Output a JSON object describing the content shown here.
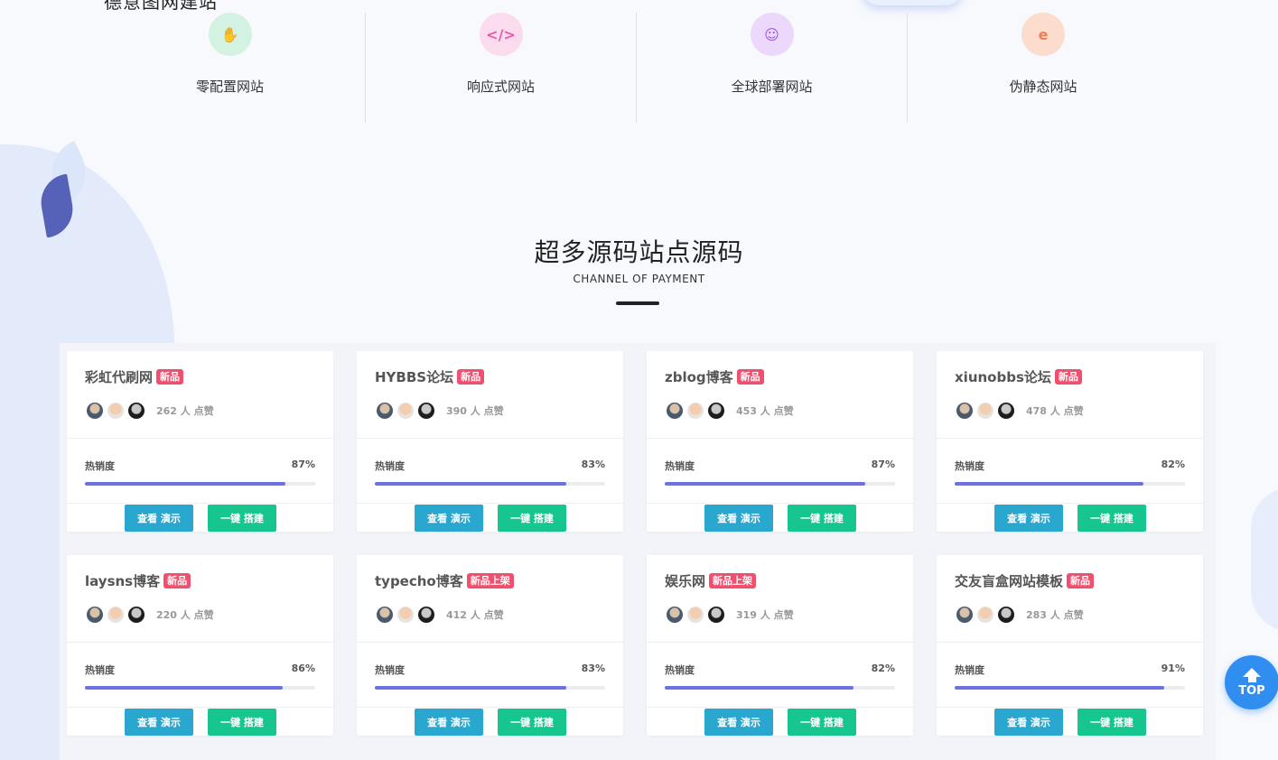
{
  "header_partial": {
    "title": "德意图网建站"
  },
  "features": [
    {
      "label": "零配置网站",
      "icon": "handshake-icon",
      "glyph": "✋",
      "bg": "#d4f2e1",
      "fg": "#3cc47c"
    },
    {
      "label": "响应式网站",
      "icon": "code-icon",
      "glyph": "</>",
      "bg": "#fbdcef",
      "fg": "#e85aa8"
    },
    {
      "label": "全球部署网站",
      "icon": "users-icon",
      "glyph": "☺",
      "bg": "#ebd8fb",
      "fg": "#9d58e0"
    },
    {
      "label": "伪静态网站",
      "icon": "edge-icon",
      "glyph": "e",
      "bg": "#fcdccd",
      "fg": "#ee7e53"
    }
  ],
  "section": {
    "title": "超多源码站点源码",
    "subtitle": "CHANNEL OF PAYMENT"
  },
  "cards": [
    {
      "title": "彩虹代刷网",
      "badge": "新品",
      "likes": "262 人 点赞",
      "hot_label": "热销度",
      "percent": "87%",
      "fill": 87,
      "demo_label": "查看 演示",
      "build_label": "一键 搭建"
    },
    {
      "title": "HYBBS论坛",
      "badge": "新品",
      "likes": "390 人 点赞",
      "hot_label": "热销度",
      "percent": "83%",
      "fill": 83,
      "demo_label": "查看 演示",
      "build_label": "一键 搭建"
    },
    {
      "title": "zblog博客",
      "badge": "新品",
      "likes": "453 人 点赞",
      "hot_label": "热销度",
      "percent": "87%",
      "fill": 87,
      "demo_label": "查看 演示",
      "build_label": "一键 搭建"
    },
    {
      "title": "xiunobbs论坛",
      "badge": "新品",
      "likes": "478 人 点赞",
      "hot_label": "热销度",
      "percent": "82%",
      "fill": 82,
      "demo_label": "查看 演示",
      "build_label": "一键 搭建"
    },
    {
      "title": "laysns博客",
      "badge": "新品",
      "likes": "220 人 点赞",
      "hot_label": "热销度",
      "percent": "86%",
      "fill": 86,
      "demo_label": "查看 演示",
      "build_label": "一键 搭建"
    },
    {
      "title": "typecho博客",
      "badge": "新品上架",
      "likes": "412 人 点赞",
      "hot_label": "热销度",
      "percent": "83%",
      "fill": 83,
      "demo_label": "查看 演示",
      "build_label": "一键 搭建"
    },
    {
      "title": "娱乐网",
      "badge": "新品上架",
      "likes": "319 人 点赞",
      "hot_label": "热销度",
      "percent": "82%",
      "fill": 82,
      "demo_label": "查看 演示",
      "build_label": "一键 搭建"
    },
    {
      "title": "交友盲盒网站模板",
      "badge": "新品",
      "likes": "283 人 点赞",
      "hot_label": "热销度",
      "percent": "91%",
      "fill": 91,
      "demo_label": "查看 演示",
      "build_label": "一键 搭建"
    }
  ],
  "top_button": {
    "label": "TOP"
  },
  "colors": {
    "accent": "#6c72df",
    "demo": "#2aa7cf",
    "build": "#17c68f",
    "badge": "#f0506e"
  }
}
